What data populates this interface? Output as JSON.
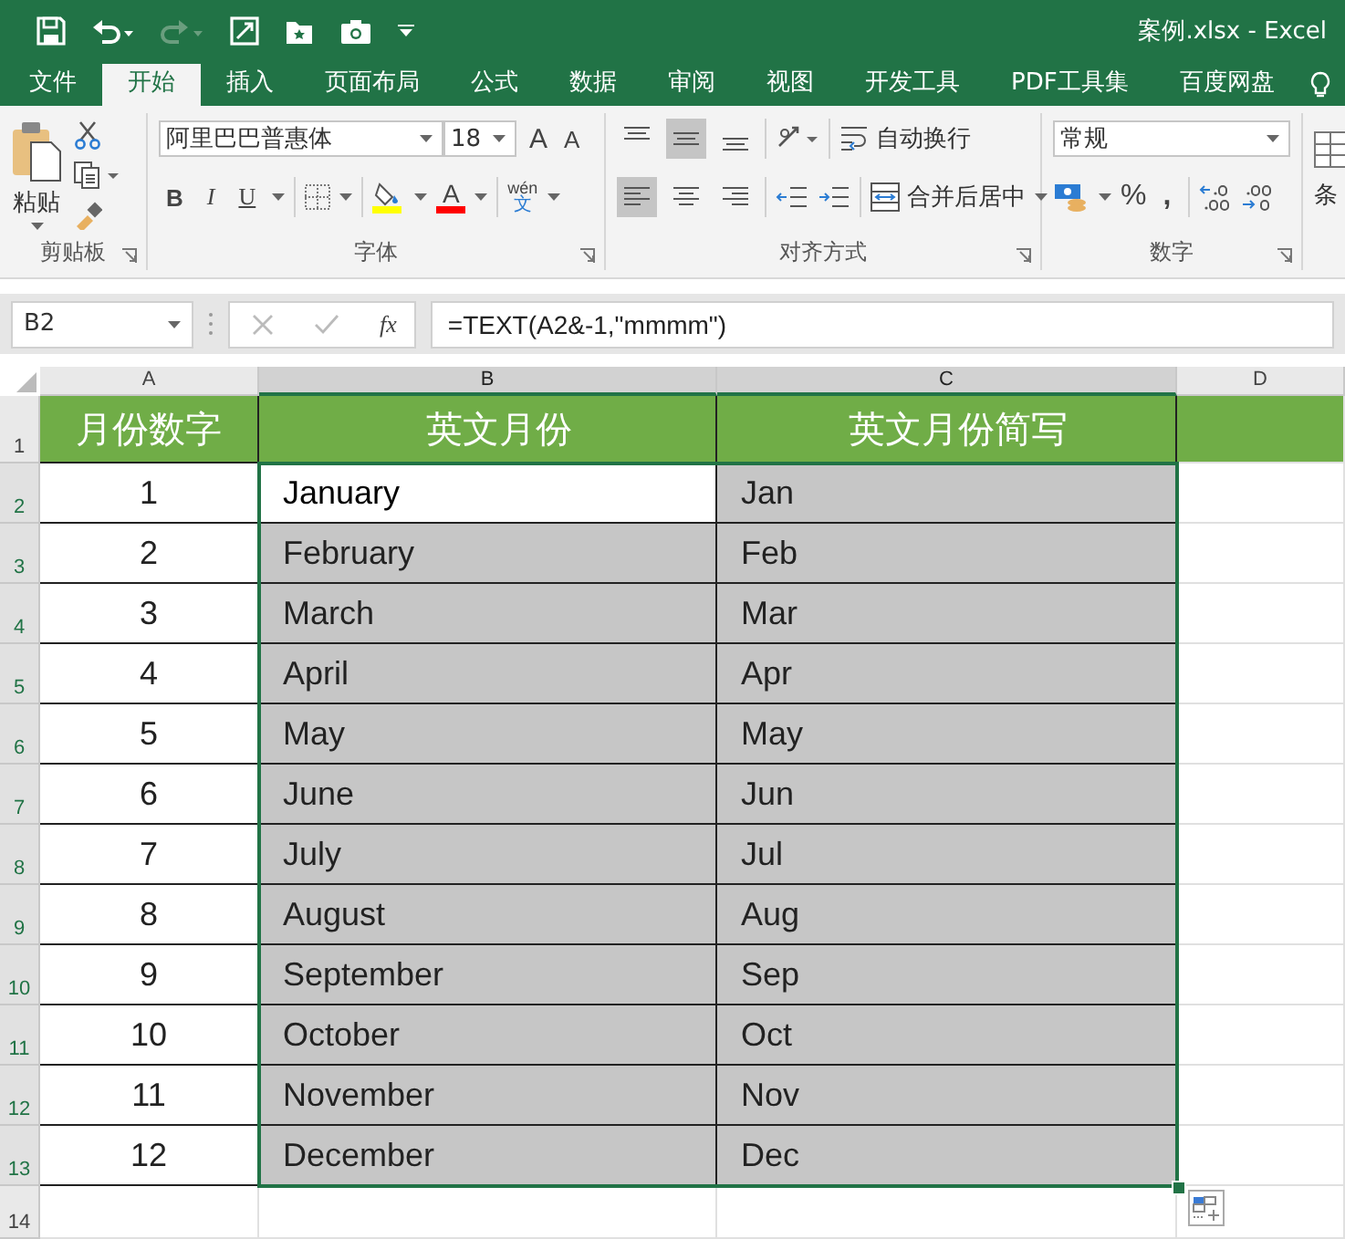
{
  "window": {
    "title": "案例.xlsx - Excel"
  },
  "ribbon_tabs": [
    {
      "label": "文件",
      "selected": false
    },
    {
      "label": "开始",
      "selected": true
    },
    {
      "label": "插入",
      "selected": false
    },
    {
      "label": "页面布局",
      "selected": false
    },
    {
      "label": "公式",
      "selected": false
    },
    {
      "label": "数据",
      "selected": false
    },
    {
      "label": "审阅",
      "selected": false
    },
    {
      "label": "视图",
      "selected": false
    },
    {
      "label": "开发工具",
      "selected": false
    },
    {
      "label": "PDF工具集",
      "selected": false
    },
    {
      "label": "百度网盘",
      "selected": false
    }
  ],
  "ribbon": {
    "paste": "粘贴",
    "font_name": "阿里巴巴普惠体",
    "font_size": "18",
    "bold": "B",
    "italic": "I",
    "underline": "U",
    "font_color_label": "A",
    "grow": "A",
    "shrink": "A",
    "phonetic": {
      "top": "wén",
      "bottom": "文"
    },
    "vertical_align": [
      {
        "selected": false
      },
      {
        "selected": true
      },
      {
        "selected": false
      }
    ],
    "horizontal_align": [
      {
        "selected": true
      },
      {
        "selected": false
      },
      {
        "selected": false
      }
    ],
    "wrap_text": "自动换行",
    "merge": "合并后居中",
    "number_format": "常规",
    "percent": "%",
    "comma": ",",
    "conditional": "条",
    "groups": [
      "剪贴板",
      "字体",
      "对齐方式",
      "数字"
    ]
  },
  "formula_bar": {
    "name_box": "B2",
    "fx": "fx",
    "formula": "=TEXT(A2&-1,\"mmmm\")"
  },
  "columns": [
    {
      "label": "A",
      "selected": false
    },
    {
      "label": "B",
      "selected": true
    },
    {
      "label": "C",
      "selected": true
    },
    {
      "label": "D",
      "selected": false
    }
  ],
  "rows": [
    {
      "number": "1",
      "selected": false,
      "kind": "header",
      "cells": [
        {
          "text": "月份数字",
          "active": false
        },
        {
          "text": "英文月份",
          "active": false
        },
        {
          "text": "英文月份简写",
          "active": false
        }
      ]
    },
    {
      "number": "2",
      "selected": true,
      "kind": "data",
      "cells": [
        {
          "text": "1",
          "active": false
        },
        {
          "text": "January",
          "active": true
        },
        {
          "text": "Jan",
          "active": false
        }
      ]
    },
    {
      "number": "3",
      "selected": true,
      "kind": "data",
      "cells": [
        {
          "text": "2",
          "active": false
        },
        {
          "text": "February",
          "active": false
        },
        {
          "text": "Feb",
          "active": false
        }
      ]
    },
    {
      "number": "4",
      "selected": true,
      "kind": "data",
      "cells": [
        {
          "text": "3",
          "active": false
        },
        {
          "text": "March",
          "active": false
        },
        {
          "text": "Mar",
          "active": false
        }
      ]
    },
    {
      "number": "5",
      "selected": true,
      "kind": "data",
      "cells": [
        {
          "text": "4",
          "active": false
        },
        {
          "text": "April",
          "active": false
        },
        {
          "text": "Apr",
          "active": false
        }
      ]
    },
    {
      "number": "6",
      "selected": true,
      "kind": "data",
      "cells": [
        {
          "text": "5",
          "active": false
        },
        {
          "text": "May",
          "active": false
        },
        {
          "text": "May",
          "active": false
        }
      ]
    },
    {
      "number": "7",
      "selected": true,
      "kind": "data",
      "cells": [
        {
          "text": "6",
          "active": false
        },
        {
          "text": "June",
          "active": false
        },
        {
          "text": "Jun",
          "active": false
        }
      ]
    },
    {
      "number": "8",
      "selected": true,
      "kind": "data",
      "cells": [
        {
          "text": "7",
          "active": false
        },
        {
          "text": "July",
          "active": false
        },
        {
          "text": "Jul",
          "active": false
        }
      ]
    },
    {
      "number": "9",
      "selected": true,
      "kind": "data",
      "cells": [
        {
          "text": "8",
          "active": false
        },
        {
          "text": "August",
          "active": false
        },
        {
          "text": "Aug",
          "active": false
        }
      ]
    },
    {
      "number": "10",
      "selected": true,
      "kind": "data",
      "cells": [
        {
          "text": "9",
          "active": false
        },
        {
          "text": "September",
          "active": false
        },
        {
          "text": "Sep",
          "active": false
        }
      ]
    },
    {
      "number": "11",
      "selected": true,
      "kind": "data",
      "cells": [
        {
          "text": "10",
          "active": false
        },
        {
          "text": "October",
          "active": false
        },
        {
          "text": "Oct",
          "active": false
        }
      ]
    },
    {
      "number": "12",
      "selected": true,
      "kind": "data",
      "cells": [
        {
          "text": "11",
          "active": false
        },
        {
          "text": "November",
          "active": false
        },
        {
          "text": "Nov",
          "active": false
        }
      ]
    },
    {
      "number": "13",
      "selected": true,
      "kind": "data",
      "cells": [
        {
          "text": "12",
          "active": false
        },
        {
          "text": "December",
          "active": false
        },
        {
          "text": "Dec",
          "active": false
        }
      ]
    },
    {
      "number": "14",
      "selected": false,
      "kind": "empty"
    }
  ]
}
